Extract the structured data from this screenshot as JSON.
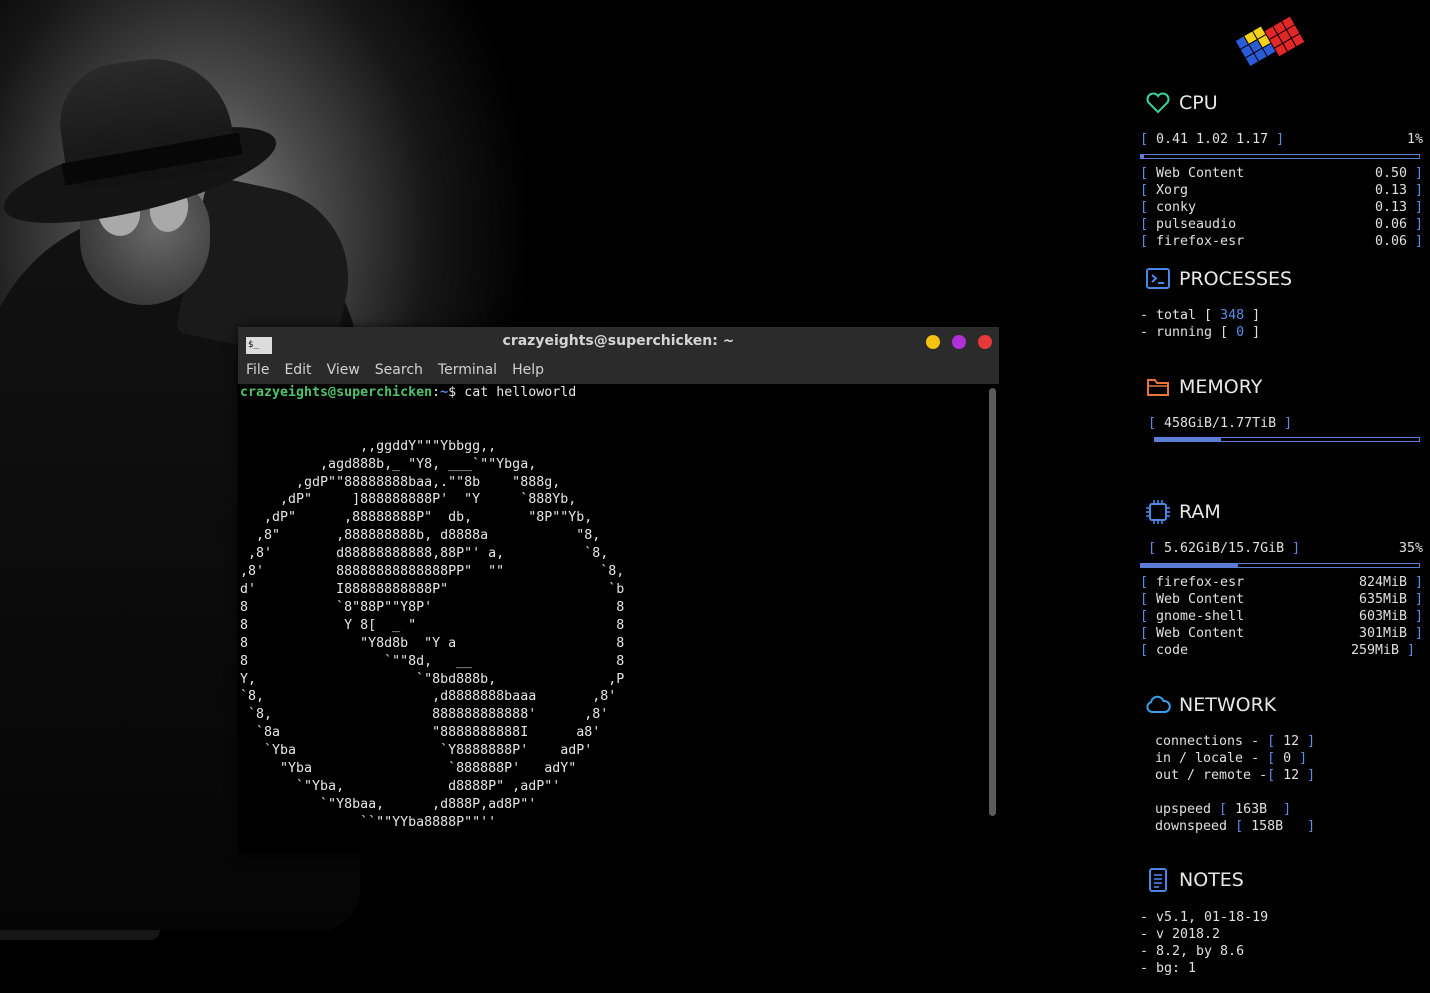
{
  "terminal": {
    "title": "crazyeights@superchicken: ~",
    "icon_text": "$_",
    "menu": [
      "File",
      "Edit",
      "View",
      "Search",
      "Terminal",
      "Help"
    ],
    "prompt_user": "crazyeights@superchicken",
    "prompt_sep": ":",
    "prompt_path": "~",
    "prompt_end": "$ ",
    "command": "cat helloworld",
    "output": "\n\n\n               ,,ggddY\"\"\"Ybbgg,,\n          ,agd888b,_ \"Y8, ___`\"\"Ybga,\n       ,gdP\"\"88888888baa,.\"\"8b    \"888g,\n     ,dP\"     ]888888888P'  \"Y     `888Yb,\n   ,dP\"      ,88888888P\"  db,       \"8P\"\"Yb,\n  ,8\"       ,888888888b, d8888a           \"8,\n ,8'        d88888888888,88P\"' a,          `8,\n,8'         88888888888888PP\"  \"\"            `8,\nd'          I88888888888P\"                    `b\n8           `8\"88P\"\"Y8P'                       8\n8            Y 8[  _ \"                         8\n8              \"Y8d8b  \"Y a                    8\n8                 `\"\"8d,   __                  8\nY,                    `\"8bd888b,              ,P\n`8,                     ,d8888888baaa       ,8'\n `8,                    888888888888'      ,8'\n  `8a                   \"8888888888I      a8'\n   `Yba                  `Y8888888P'    adP'\n     \"Yba                 `888888P'   adY\"\n       `\"Yba,             d8888P\" ,adP\"'\n          `\"Y8baa,      ,d888P,ad8P\"'\n               ``\"\"YYba8888P\"\"''"
  },
  "conky": {
    "cpu": {
      "title": "CPU",
      "loadavg": "0.41 1.02 1.17",
      "percent": "1%",
      "usage_fraction": 0.01,
      "processes": [
        {
          "name": "Web Content",
          "value": "0.50"
        },
        {
          "name": "Xorg",
          "value": "0.13"
        },
        {
          "name": "conky",
          "value": "0.13"
        },
        {
          "name": "pulseaudio",
          "value": "0.06"
        },
        {
          "name": "firefox-esr",
          "value": "0.06"
        }
      ]
    },
    "processes": {
      "title": "PROCESSES",
      "total_label": "- total [ ",
      "total": "348",
      "running_label": "- running [ ",
      "running": "0"
    },
    "memory": {
      "title": "MEMORY",
      "value": "458GiB/1.77TiB",
      "usage_fraction": 0.25
    },
    "ram": {
      "title": "RAM",
      "value": "5.62GiB/15.7GiB",
      "percent": "35%",
      "usage_fraction": 0.35,
      "processes": [
        {
          "name": "firefox-esr",
          "value": "824MiB"
        },
        {
          "name": "Web Content",
          "value": "635MiB"
        },
        {
          "name": "gnome-shell",
          "value": "603MiB"
        },
        {
          "name": "Web Content",
          "value": "301MiB"
        },
        {
          "name": "code",
          "value": "259MiB"
        }
      ]
    },
    "network": {
      "title": "NETWORK",
      "connections_label": "connections - ",
      "connections": "12",
      "in_label": "in / locale - ",
      "in": "0",
      "out_label": "out / remote -",
      "out": "12",
      "upspeed_label": "upspeed ",
      "upspeed": "163B",
      "downspeed_label": "downspeed ",
      "downspeed": "158B"
    },
    "notes": {
      "title": "NOTES",
      "items": [
        "- v5.1, 01-18-19",
        "- v 2018.2",
        "- 8.2, by 8.6",
        "- bg: 1"
      ]
    }
  },
  "colors": {
    "accent_blue": "#5b8ee6",
    "prompt_green": "#4fc26c",
    "cpu_icon": "#3ccf9a",
    "processes_icon": "#4a86e8",
    "memory_icon": "#e8763a",
    "ram_icon": "#4a86e8",
    "network_icon": "#3aa0e8",
    "notes_icon": "#4a86e8"
  }
}
